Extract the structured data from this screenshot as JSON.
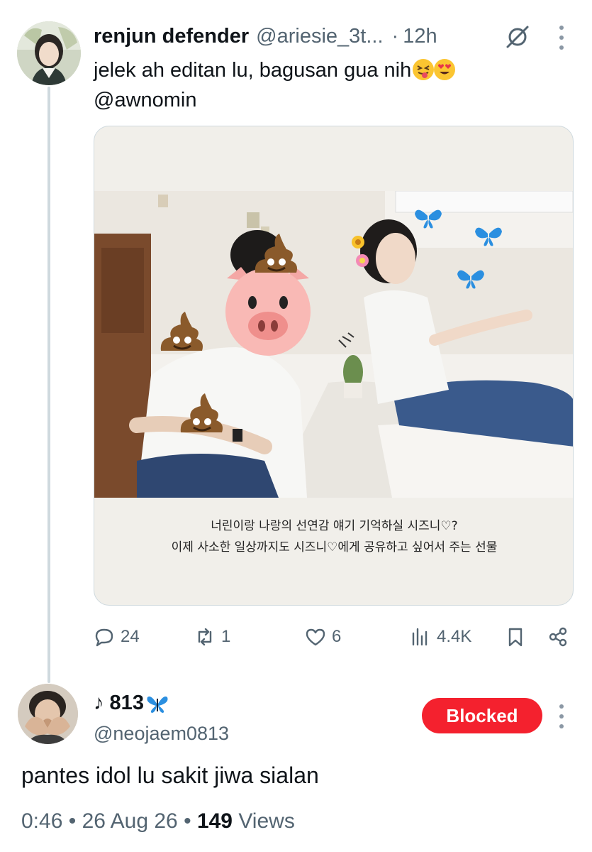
{
  "tweet": {
    "author_name": "renjun defender",
    "author_handle": "@ariesie_3t...",
    "separator": "·",
    "time": "12h",
    "text_line1": "jelek ah editan lu, bagusan gua nih",
    "text_line2": "@awnomin",
    "emojis": [
      "squinting-tongue-face",
      "heart-eyes-face"
    ],
    "media": {
      "caption_line1": "너린이랑 나랑의 선연감 얘기 기억하실 시즈니♡?",
      "caption_line2": "이제 사소한 일상까지도 시즈니♡에게 공유하고 싶어서 주는 선물",
      "overlay_emojis": [
        "pig-face",
        "pile-of-poo",
        "butterfly",
        "flower"
      ]
    },
    "stats": {
      "replies": "24",
      "reposts": "1",
      "likes": "6",
      "views": "4.4K"
    }
  },
  "reply": {
    "author_name": "♪ 813",
    "name_emoji": "butterfly",
    "author_handle": "@neojaem0813",
    "blocked_label": "Blocked",
    "text": "pantes idol lu sakit jiwa sialan",
    "time": "0:46",
    "date": "26 Aug 26",
    "dot": "•",
    "views_count": "149",
    "views_label": "Views"
  },
  "colors": {
    "text_primary": "#0f1419",
    "text_secondary": "#536471",
    "blocked_red": "#f4212e",
    "thread_line": "#cfd9de",
    "butterfly_blue": "#2b8fe0"
  }
}
